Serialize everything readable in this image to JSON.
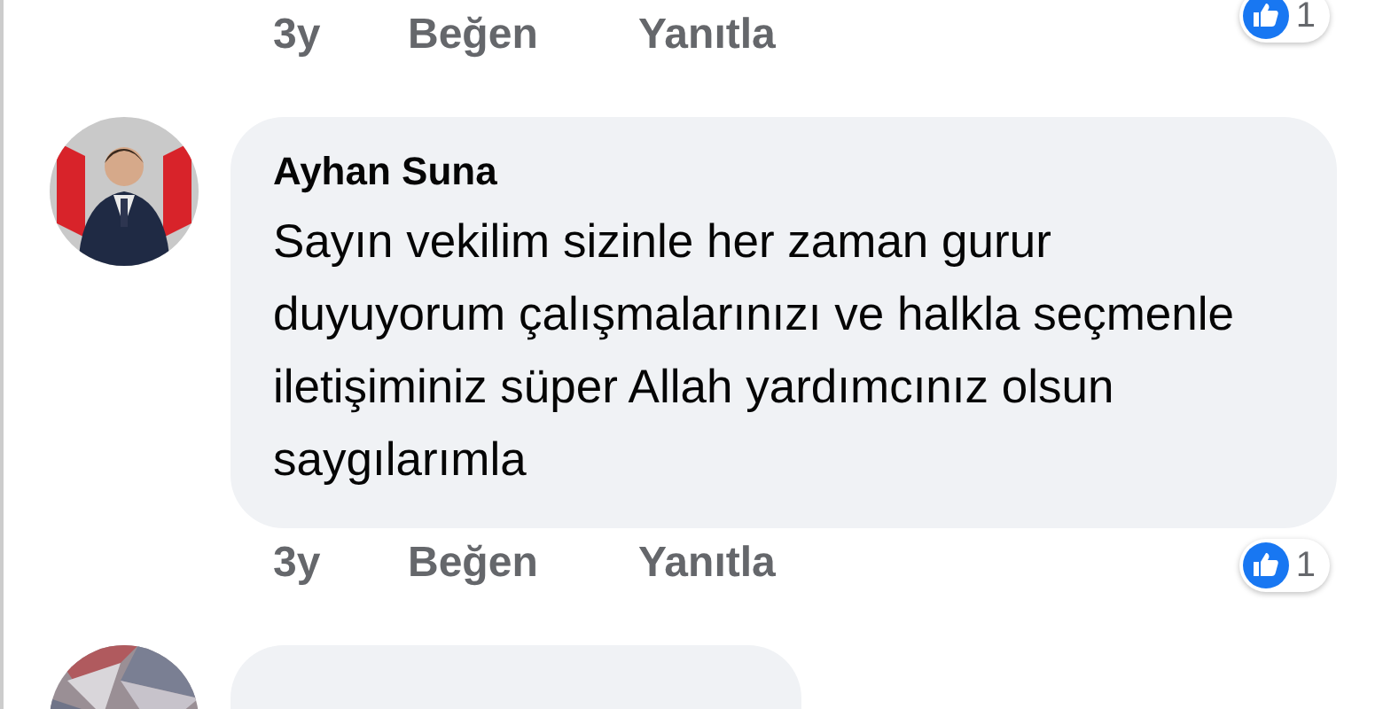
{
  "comments": [
    {
      "actions": {
        "time": "3y",
        "like": "Beğen",
        "reply": "Yanıtla"
      },
      "reactions": {
        "count": "1"
      }
    },
    {
      "avatar": {
        "kind": "picture"
      },
      "author": "Ayhan Suna",
      "text": "Sayın vekilim sizinle her zaman gurur duyuyorum çalışmalarınızı ve halkla seçmenle iletişiminiz süper Allah yardımcınız olsun saygılarımla",
      "actions": {
        "time": "3y",
        "like": "Beğen",
        "reply": "Yanıtla"
      },
      "reactions": {
        "count": "1"
      }
    },
    {
      "avatar": {
        "kind": "picture"
      }
    }
  ]
}
